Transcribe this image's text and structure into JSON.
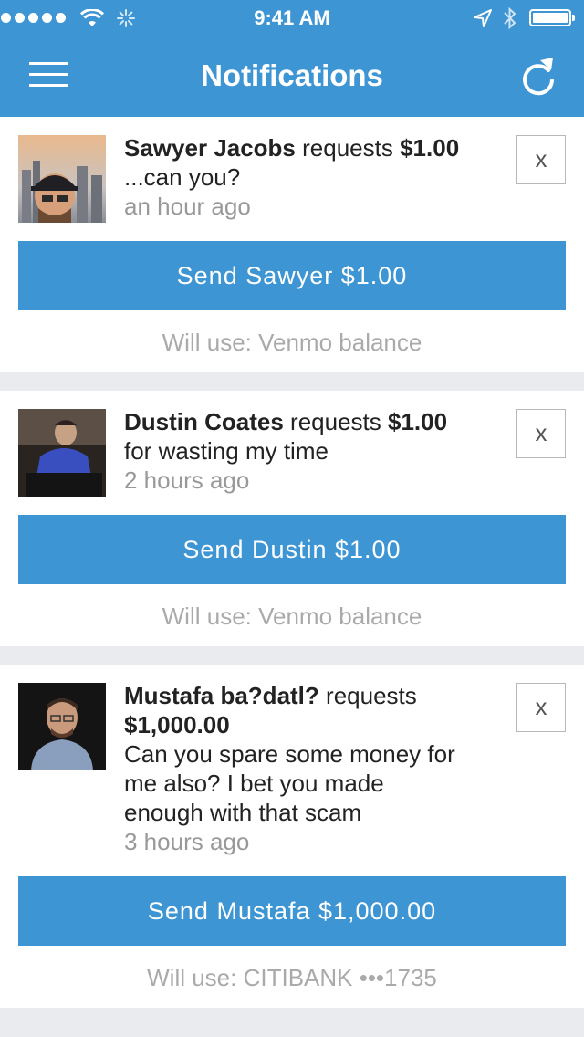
{
  "status_bar": {
    "time": "9:41 AM"
  },
  "header": {
    "title": "Notifications",
    "menu_icon": "hamburger-menu-icon",
    "refresh_icon": "refresh-icon"
  },
  "colors": {
    "brand": "#3d95d3",
    "gap": "#e9ebee",
    "muted": "#999999"
  },
  "notifications": [
    {
      "name": "Sawyer Jacobs",
      "verb": "requests",
      "amount": "$1.00",
      "line_1": "...can you?",
      "time_ago": "an hour ago",
      "close_label": "x",
      "send_label": "Send Sawyer $1.00",
      "funding": "Will use: Venmo balance"
    },
    {
      "name": "Dustin Coates",
      "verb": "requests",
      "amount": "$1.00",
      "line_1": "for wasting my time",
      "time_ago": "2 hours ago",
      "close_label": "x",
      "send_label": "Send Dustin $1.00",
      "funding": "Will use: Venmo balance"
    },
    {
      "name": "Mustafa ba?datl?",
      "verb": "requests",
      "amount": "$1,000.00",
      "line_1": "Can you spare some money for",
      "line_2": "me also? I bet you made",
      "line_3": "enough with that scam",
      "time_ago": "3 hours ago",
      "close_label": "x",
      "send_label": "Send Mustafa $1,000.00",
      "funding": "Will use: CITIBANK •••1735"
    }
  ]
}
